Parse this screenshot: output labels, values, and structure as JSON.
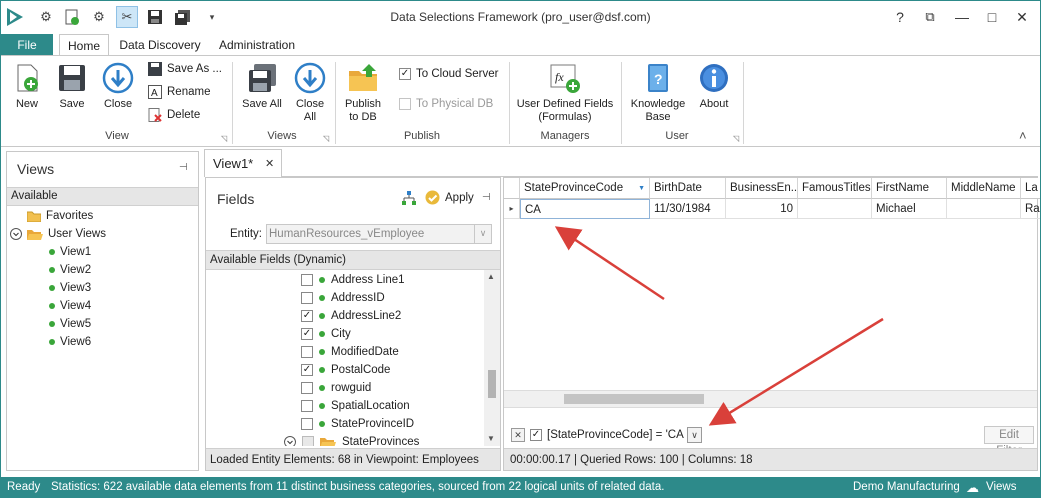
{
  "window": {
    "title": "Data Selections Framework (pro_user@dsf.com)",
    "help": "?",
    "restore_glyph": "⧉",
    "minimize_glyph": "—",
    "maximize_glyph": "□",
    "close_glyph": "✕",
    "quick_access_more": "▾"
  },
  "ribbon_tabs": [
    "File",
    "Home",
    "Data Discovery",
    "Administration"
  ],
  "ribbon": {
    "view_group": {
      "label": "View",
      "new": "New",
      "save": "Save",
      "close": "Close",
      "save_as": "Save As ...",
      "rename": "Rename",
      "delete": "Delete"
    },
    "views_group": {
      "label": "Views",
      "save_all": "Save All",
      "close_all_l1": "Close",
      "close_all_l2": "All"
    },
    "publish_group": {
      "label": "Publish",
      "publish_l1": "Publish",
      "publish_l2": "to DB",
      "to_cloud": "To Cloud Server",
      "to_physical": "To Physical DB"
    },
    "managers_group": {
      "label": "Managers",
      "udf_l1": "User Defined Fields",
      "udf_l2": "(Formulas)"
    },
    "user_group": {
      "label": "User",
      "kb_l1": "Knowledge",
      "kb_l2": "Base",
      "about": "About"
    },
    "collapse_glyph": "˄"
  },
  "views_pane": {
    "title": "Views",
    "pin": "⊣",
    "section": "Available",
    "favorites": "Favorites",
    "user_views": "User Views",
    "items": [
      "View1",
      "View2",
      "View3",
      "View4",
      "View5",
      "View6"
    ]
  },
  "doc_tab": {
    "label": "View1*",
    "close": "✕"
  },
  "fields_pane": {
    "title": "Fields",
    "apply": "Apply",
    "entity_label": "Entity:",
    "entity_value": "HumanResources_vEmployee",
    "available_header": "Available Fields (Dynamic)",
    "fields": [
      {
        "name": "Address Line1",
        "checked": false
      },
      {
        "name": "AddressID",
        "checked": false
      },
      {
        "name": "AddressLine2",
        "checked": true
      },
      {
        "name": "City",
        "checked": true
      },
      {
        "name": "ModifiedDate",
        "checked": false
      },
      {
        "name": "PostalCode",
        "checked": true
      },
      {
        "name": "rowguid",
        "checked": false
      },
      {
        "name": "SpatialLocation",
        "checked": false
      },
      {
        "name": "StateProvinceID",
        "checked": false
      },
      {
        "name": "StateProvinces",
        "checked": false
      }
    ],
    "footer": "Loaded Entity Elements: 68 in Viewpoint: Employees"
  },
  "grid": {
    "columns": [
      "StateProvinceCode",
      "BirthDate",
      "BusinessEn...",
      "FamousTitles",
      "FirstName",
      "MiddleName",
      "La"
    ],
    "row": [
      "CA",
      "11/30/1984",
      "10",
      "",
      "Michael",
      "",
      "Ra"
    ],
    "filter_text": "[StateProvinceCode] = 'CA '",
    "edit_filter": "Edit Filter",
    "stats": "00:00:00.17 | Queried Rows: 100 | Columns: 18"
  },
  "status": {
    "ready": "Ready",
    "statistics": "Statistics: 622 available data elements from 11 distinct business categories, sourced from 22 logical units of related data.",
    "company": "Demo Manufacturing",
    "views": "Views"
  },
  "colors": {
    "accent": "#2d8a8a",
    "arrow": "#d9403a"
  }
}
